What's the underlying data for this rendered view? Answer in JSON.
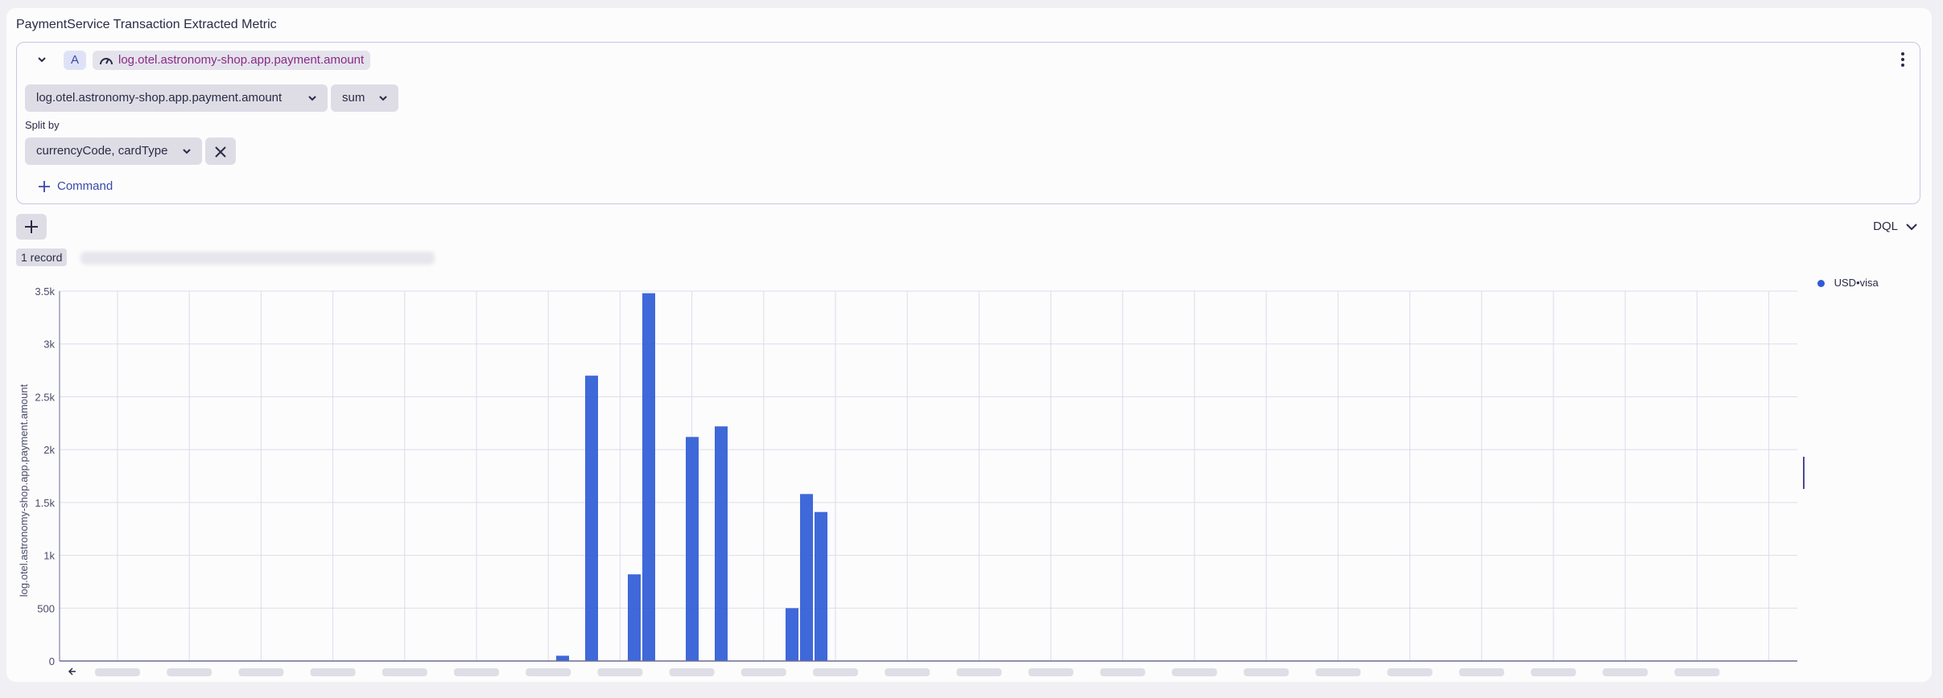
{
  "panel": {
    "title": "PaymentService Transaction Extracted Metric"
  },
  "query": {
    "letter": "A",
    "metric_pill": "log.otel.astronomy-shop.app.payment.amount",
    "metric_select": "log.otel.astronomy-shop.app.payment.amount",
    "aggregation": "sum",
    "split_label": "Split by",
    "split_value": "currencyCode, cardType",
    "command_label": "Command"
  },
  "toolbar": {
    "language": "DQL",
    "records": "1 record"
  },
  "legend": {
    "items": [
      {
        "label": "USD•visa",
        "color": "#2f5bd6"
      }
    ]
  },
  "chart_data": {
    "type": "bar",
    "ylabel": "log.otel.astronomy-shop.app.payment.amount",
    "ylim": [
      0,
      3500
    ],
    "yticks": [
      0,
      500,
      1000,
      1500,
      2000,
      2500,
      3000,
      3500
    ],
    "ytick_labels": [
      "0",
      "500",
      "1k",
      "1.5k",
      "2k",
      "2.5k",
      "3k",
      "3.5k"
    ],
    "grid": true,
    "legend_position": "top-right",
    "series": [
      {
        "name": "USD•visa",
        "color": "#2f5bd6",
        "values": [
          50,
          2700,
          820,
          3480,
          2120,
          2220,
          500,
          1580,
          1410
        ]
      }
    ]
  }
}
